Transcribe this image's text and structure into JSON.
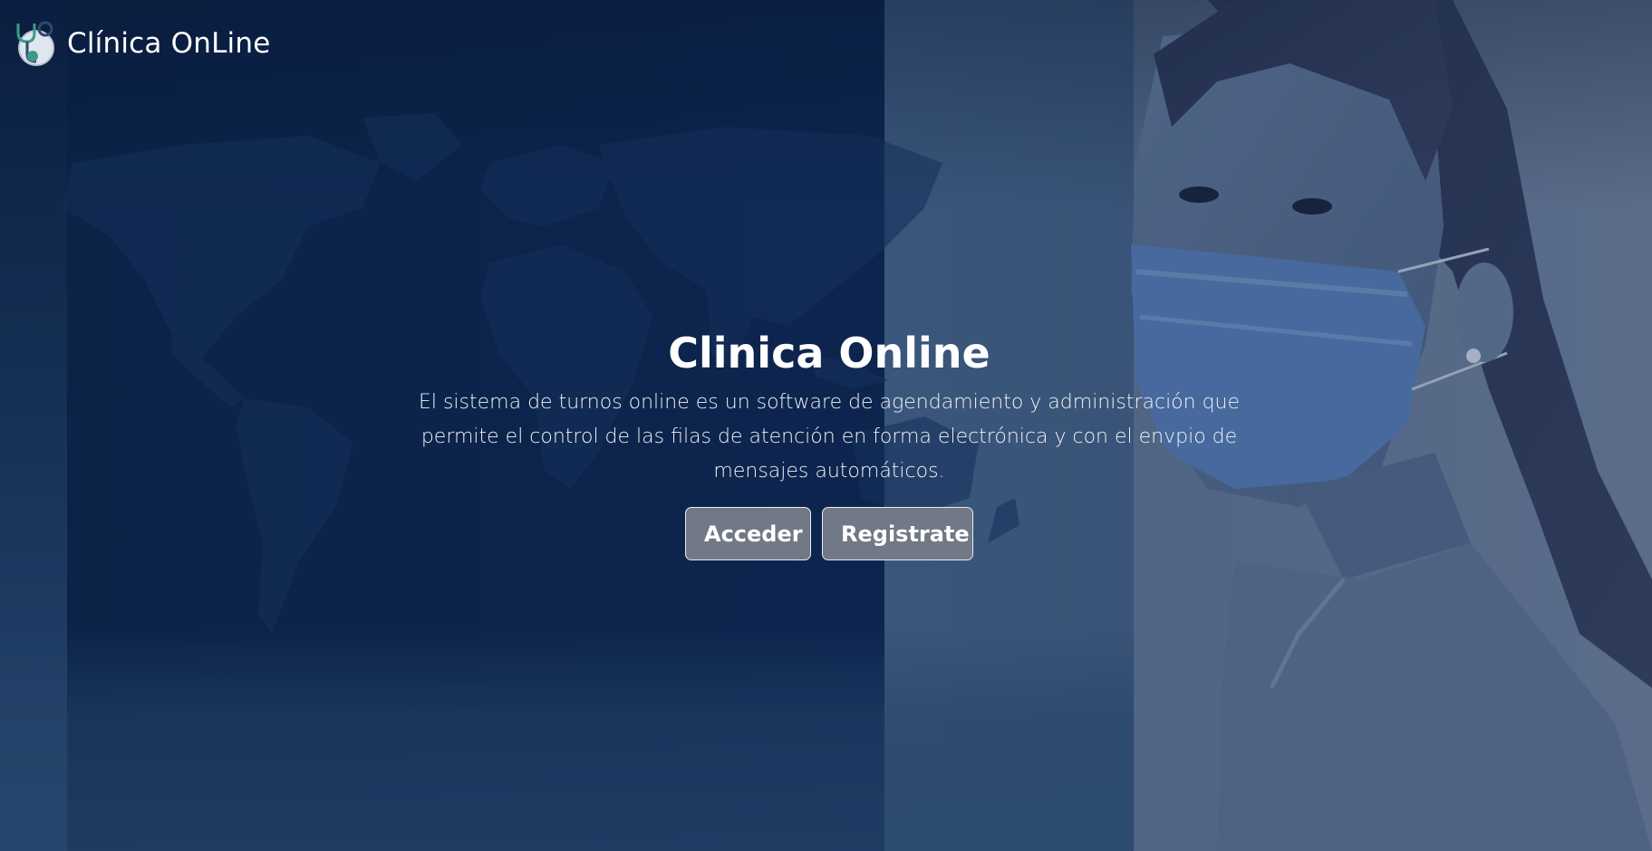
{
  "brand": {
    "name": "Clínica OnLine",
    "logo_icon": "stethoscope-icon"
  },
  "hero": {
    "title": "Clinica Online",
    "description": "El sistema de turnos online es un software de agendamiento y administración que permite el control de las filas de atención en forma electrónica y con el envpio de mensajes automáticos.",
    "buttons": {
      "login_label": "Acceder",
      "register_label": "Registrate"
    }
  },
  "colors": {
    "button_bg": "#707985",
    "overlay": "#0e2650",
    "text": "#ffffff"
  }
}
